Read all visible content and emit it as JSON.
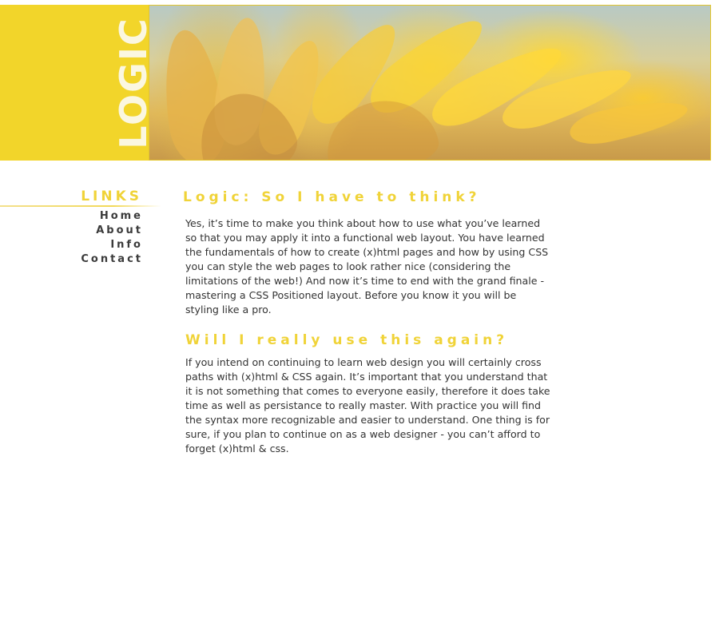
{
  "header": {
    "logo_text": "LOGIC"
  },
  "sidebar": {
    "title": "LINKS",
    "items": [
      {
        "label": "Home"
      },
      {
        "label": "About"
      },
      {
        "label": "Info"
      },
      {
        "label": "Contact"
      }
    ]
  },
  "main": {
    "sections": [
      {
        "heading": "Logic: So I have to think?",
        "body": "Yes, it’s time to make you think about how to use what you’ve learned so that you may apply it into a functional web layout. You have learned the fundamentals of how to create (x)html pages and how by using CSS you can style the web pages to look rather nice (considering the limitations of the web!) And now it’s time to end with the grand finale - mastering a CSS Positioned layout. Before you know it you will be styling like a pro."
      },
      {
        "heading": "Will I really use this again?",
        "body": "If you intend on continuing to learn web design you will certainly cross paths with (x)html & CSS again. It’s important that you understand that it is not something that comes to everyone easily, therefore it does take time as well as persistance to really master. With practice you will find the syntax more recognizable and easier to understand. One thing is for sure, if you plan to continue on as a web designer - you can’t afford to forget (x)html & css."
      }
    ]
  },
  "colors": {
    "brand_yellow": "#f2d52a",
    "heading_yellow": "#f0d338",
    "nav_text": "#3b3b3b",
    "body_text": "#333333"
  }
}
